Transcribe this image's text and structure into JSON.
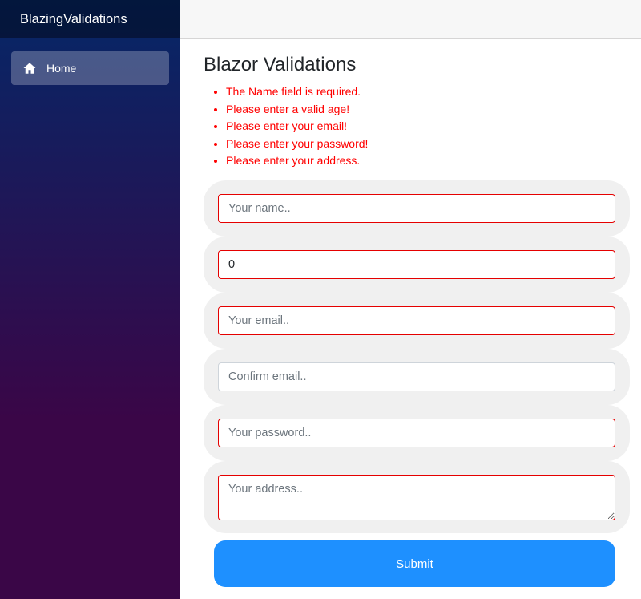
{
  "app": {
    "brand": "BlazingValidations"
  },
  "sidebar": {
    "items": [
      {
        "label": "Home",
        "icon": "home-icon"
      }
    ]
  },
  "page": {
    "title": "Blazor Validations"
  },
  "validation_errors": [
    "The Name field is required.",
    "Please enter a valid age!",
    "Please enter your email!",
    "Please enter your password!",
    "Please enter your address."
  ],
  "form": {
    "name": {
      "value": "",
      "placeholder": "Your name..",
      "invalid": true
    },
    "age": {
      "value": "0",
      "placeholder": "",
      "invalid": true
    },
    "email": {
      "value": "",
      "placeholder": "Your email..",
      "invalid": true
    },
    "confirm_email": {
      "value": "",
      "placeholder": "Confirm email..",
      "invalid": false
    },
    "password": {
      "value": "",
      "placeholder": "Your password..",
      "invalid": true
    },
    "address": {
      "value": "",
      "placeholder": "Your address..",
      "invalid": true
    },
    "submit_label": "Submit"
  },
  "colors": {
    "sidebar_top": "#052767",
    "sidebar_bottom": "#3a0647",
    "error": "#ff0000",
    "invalid_border": "#e50000",
    "submit": "#1e90ff",
    "field_row_bg": "#f0f0f0"
  }
}
